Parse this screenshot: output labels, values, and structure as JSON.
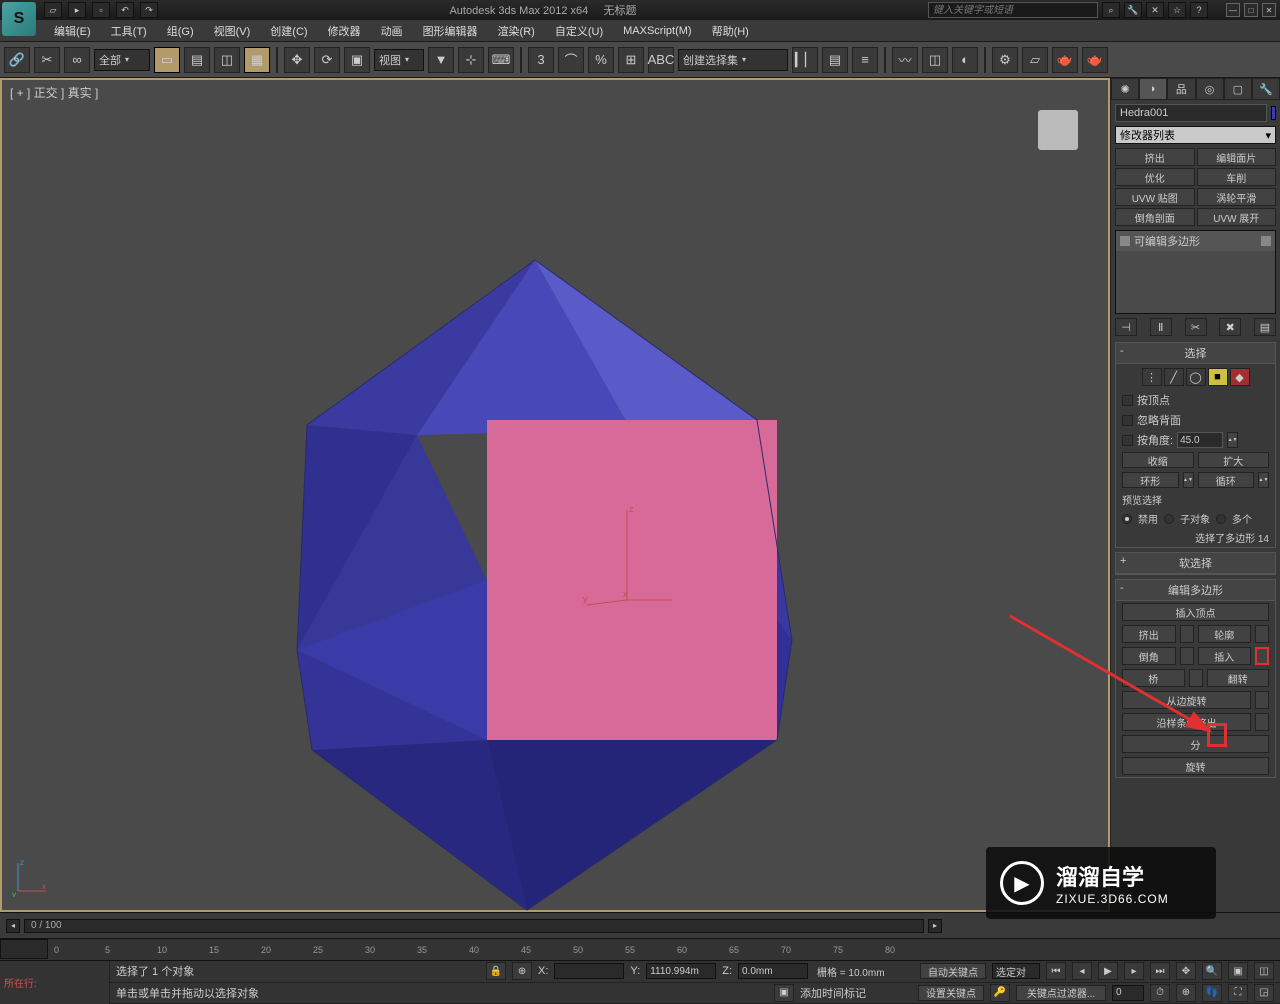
{
  "app": {
    "title": "Autodesk 3ds Max  2012 x64",
    "doc_title": "无标题",
    "search_placeholder": "键入关键字或短语"
  },
  "menu": [
    "编辑(E)",
    "工具(T)",
    "组(G)",
    "视图(V)",
    "创建(C)",
    "修改器",
    "动画",
    "图形编辑器",
    "渲染(R)",
    "自定义(U)",
    "MAXScript(M)",
    "帮助(H)"
  ],
  "toolbar": {
    "sel_filter": "全部",
    "ref_coord": "视图",
    "named_sel": "创建选择集"
  },
  "viewport": {
    "label": "[ + ] 正交 ] 真实 ]"
  },
  "cmd": {
    "object_name": "Hedra001",
    "mod_list_label": "修改器列表",
    "mod_buttons": [
      "挤出",
      "编辑面片",
      "优化",
      "车削",
      "UVW 贴图",
      "涡轮平滑",
      "倒角剖面",
      "UVW 展开"
    ],
    "stack_item": "可编辑多边形",
    "selection": {
      "title": "选择",
      "by_vertex": "按顶点",
      "ignore_back": "忽略背面",
      "by_angle": "按角度:",
      "angle_val": "45.0",
      "shrink": "收缩",
      "grow": "扩大",
      "ring": "环形",
      "loop": "循环",
      "preview": "预览选择",
      "off": "禁用",
      "subobj": "子对象",
      "multi": "多个",
      "info": "选择了多边形 14"
    },
    "soft_sel": {
      "title": "软选择"
    },
    "edit_poly": {
      "title": "编辑多边形",
      "insert_vertex": "插入顶点",
      "extrude": "挤出",
      "outline": "轮廓",
      "bevel": "倒角",
      "inset": "插入",
      "bridge": "桥",
      "flip": "翻转",
      "hinge": "从边旋转",
      "extrude_spline": "沿样条线挤出",
      "edit_tri": "分",
      "turn": "旋转"
    }
  },
  "timeslider": {
    "label": "0 / 100"
  },
  "timeruler_ticks": [
    0,
    5,
    10,
    15,
    20,
    25,
    30,
    35,
    40,
    45,
    50,
    55,
    60,
    65,
    70,
    75,
    80
  ],
  "status": {
    "script_label": "所在行:",
    "sel_info": "选择了 1 个对象",
    "prompt": "单击或单击并拖动以选择对象",
    "x": "X:",
    "y": "Y:",
    "z": "Z:",
    "y_val": "1110.994m",
    "z_val": "0.0mm",
    "grid": "栅格 = 10.0mm",
    "autokey": "自动关键点",
    "selected": "选定对",
    "setkey": "设置关键点",
    "keyfilter": "关键点过滤器...",
    "addtime": "添加时间标记"
  },
  "watermark": {
    "brand": "溜溜自学",
    "url": "ZIXUE.3D66.COM"
  }
}
